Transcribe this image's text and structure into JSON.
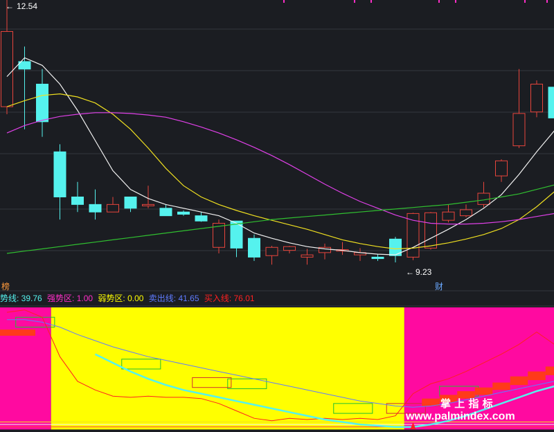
{
  "colors": {
    "background": "#1b1d22",
    "grid": "#33363d",
    "up": "#e8453c",
    "down": "#55f2ee",
    "ma5": "#f2f2f2",
    "ma10": "#f0e020",
    "ma20": "#e040e8",
    "ma60": "#30c030",
    "strong_zone": "#ff0aa0",
    "weak_zone": "#ffff00",
    "trend_line": "#4aa8ff",
    "sell_line": "#5f7bff",
    "buy_line": "#ff2020",
    "box_green": "#20c030",
    "box_red": "#d03030",
    "watermark": "#ffffff",
    "marker": "#ff2ec8"
  },
  "price_panel": {
    "high_label": "12.54",
    "low_label": "9.23",
    "left_badge": "榜",
    "right_badge": "财"
  },
  "indicator_legend": [
    {
      "label": "势线: 39.76",
      "color": "#55f2ee"
    },
    {
      "label": "强势区: 1.00",
      "color": "#ff2ec8"
    },
    {
      "label": "弱势区: 0.00",
      "color": "#ffff00"
    },
    {
      "label": "卖出线: 41.65",
      "color": "#5f7bff"
    },
    {
      "label": "买入线: 76.01",
      "color": "#ff2020"
    }
  ],
  "watermark": {
    "line1": "掌 上 指 标",
    "line2": "www.palmindex.com"
  },
  "chart_data": {
    "type": "candlestick",
    "price_axis": [
      9.0,
      12.7
    ],
    "candles": [
      {
        "o": 11.3,
        "h": 12.8,
        "l": 11.2,
        "c": 12.3
      },
      {
        "o": 11.9,
        "h": 12.1,
        "l": 11.0,
        "c": 11.8
      },
      {
        "o": 11.6,
        "h": 11.8,
        "l": 10.9,
        "c": 11.1
      },
      {
        "o": 10.7,
        "h": 10.8,
        "l": 9.8,
        "c": 10.1
      },
      {
        "o": 10.1,
        "h": 10.3,
        "l": 9.9,
        "c": 10.0
      },
      {
        "o": 10.0,
        "h": 10.2,
        "l": 9.8,
        "c": 9.9
      },
      {
        "o": 9.9,
        "h": 10.1,
        "l": 9.9,
        "c": 10.0
      },
      {
        "o": 10.1,
        "h": 10.1,
        "l": 9.9,
        "c": 9.95
      },
      {
        "o": 10.0,
        "h": 10.25,
        "l": 9.95,
        "c": 10.0
      },
      {
        "o": 9.95,
        "h": 10.0,
        "l": 9.85,
        "c": 9.85
      },
      {
        "o": 9.9,
        "h": 9.92,
        "l": 9.85,
        "c": 9.87
      },
      {
        "o": 9.85,
        "h": 9.9,
        "l": 9.77,
        "c": 9.78
      },
      {
        "o": 9.43,
        "h": 9.8,
        "l": 9.35,
        "c": 9.75
      },
      {
        "o": 9.78,
        "h": 9.78,
        "l": 9.3,
        "c": 9.42
      },
      {
        "o": 9.55,
        "h": 9.6,
        "l": 9.25,
        "c": 9.3
      },
      {
        "o": 9.32,
        "h": 9.45,
        "l": 9.2,
        "c": 9.43
      },
      {
        "o": 9.39,
        "h": 9.45,
        "l": 9.35,
        "c": 9.44
      },
      {
        "o": 9.3,
        "h": 9.41,
        "l": 9.2,
        "c": 9.33
      },
      {
        "o": 9.36,
        "h": 9.48,
        "l": 9.27,
        "c": 9.43
      },
      {
        "o": 9.38,
        "h": 9.5,
        "l": 9.33,
        "c": 9.4
      },
      {
        "o": 9.33,
        "h": 9.42,
        "l": 9.25,
        "c": 9.36
      },
      {
        "o": 9.3,
        "h": 9.34,
        "l": 9.25,
        "c": 9.28
      },
      {
        "o": 9.54,
        "h": 9.57,
        "l": 9.23,
        "c": 9.32
      },
      {
        "o": 9.3,
        "h": 9.89,
        "l": 9.26,
        "c": 9.88
      },
      {
        "o": 9.42,
        "h": 9.9,
        "l": 9.4,
        "c": 9.89
      },
      {
        "o": 9.79,
        "h": 10.0,
        "l": 9.76,
        "c": 9.9
      },
      {
        "o": 9.85,
        "h": 10.0,
        "l": 9.83,
        "c": 9.93
      },
      {
        "o": 10.0,
        "h": 10.3,
        "l": 9.96,
        "c": 10.15
      },
      {
        "o": 10.38,
        "h": 10.6,
        "l": 10.3,
        "c": 10.58
      },
      {
        "o": 10.78,
        "h": 11.8,
        "l": 10.75,
        "c": 11.21
      },
      {
        "o": 11.23,
        "h": 11.65,
        "l": 11.16,
        "c": 11.6
      },
      {
        "o": 11.56,
        "h": 11.59,
        "l": 11.05,
        "c": 11.15
      },
      {
        "o": 11.35,
        "h": 12.0,
        "l": 10.9,
        "c": 11.75
      }
    ],
    "ma_series": [
      {
        "key": "ma5",
        "values": [
          11.7,
          11.95,
          11.85,
          11.6,
          11.25,
          10.85,
          10.45,
          10.2,
          10.08,
          10.0,
          9.95,
          9.9,
          9.85,
          9.75,
          9.62,
          9.55,
          9.49,
          9.44,
          9.41,
          9.39,
          9.36,
          9.34,
          9.33,
          9.43,
          9.55,
          9.67,
          9.8,
          9.95,
          10.13,
          10.4,
          10.7,
          10.98,
          11.2
        ]
      },
      {
        "key": "ma10",
        "values": [
          11.3,
          11.38,
          11.45,
          11.47,
          11.43,
          11.35,
          11.2,
          11.0,
          10.75,
          10.48,
          10.25,
          10.1,
          10.0,
          9.92,
          9.85,
          9.79,
          9.73,
          9.67,
          9.6,
          9.53,
          9.48,
          9.44,
          9.41,
          9.42,
          9.45,
          9.49,
          9.54,
          9.6,
          9.68,
          9.8,
          9.97,
          10.17,
          10.38
        ]
      },
      {
        "key": "ma20",
        "values": [
          10.95,
          11.05,
          11.12,
          11.17,
          11.2,
          11.22,
          11.22,
          11.21,
          11.19,
          11.16,
          11.1,
          11.03,
          10.95,
          10.86,
          10.76,
          10.65,
          10.53,
          10.4,
          10.27,
          10.15,
          10.04,
          9.95,
          9.86,
          9.79,
          9.75,
          9.74,
          9.74,
          9.75,
          9.77,
          9.8,
          9.84,
          9.88,
          9.93
        ]
      },
      {
        "key": "ma60",
        "values": [
          9.35,
          9.38,
          9.41,
          9.44,
          9.47,
          9.5,
          9.53,
          9.56,
          9.59,
          9.62,
          9.65,
          9.68,
          9.71,
          9.74,
          9.77,
          9.8,
          9.82,
          9.84,
          9.86,
          9.88,
          9.9,
          9.92,
          9.94,
          9.96,
          9.98,
          10.0,
          10.03,
          10.06,
          10.1,
          10.14,
          10.2,
          10.26,
          10.33
        ]
      }
    ],
    "indicator": {
      "range": [
        0,
        100
      ],
      "strong_zone_spans": [
        [
          0,
          2
        ],
        [
          23,
          32
        ]
      ],
      "weak_zone_spans": [
        [
          3,
          22
        ]
      ],
      "zone_band": [
        0.9,
        100
      ],
      "trend_line": [
        88,
        88,
        85,
        78,
        68,
        62,
        55,
        48,
        42,
        37,
        33,
        30,
        27,
        24,
        21,
        18,
        15,
        12,
        9,
        7,
        5,
        4,
        3,
        3,
        5,
        8,
        12,
        17,
        22,
        27,
        32,
        36,
        40
      ],
      "sell_line": [
        90,
        90,
        88,
        84,
        78,
        73,
        68,
        64,
        60,
        57,
        54,
        51,
        48,
        45,
        42,
        39,
        36,
        33,
        30,
        27,
        24,
        22,
        20,
        19,
        20,
        22,
        25,
        28,
        31,
        34,
        37,
        40,
        42
      ],
      "buy_line": [
        96,
        98,
        92,
        60,
        40,
        33,
        28,
        27,
        28,
        27,
        27,
        26,
        22,
        16,
        10,
        8,
        10,
        9,
        10,
        9,
        10,
        9,
        12,
        30,
        38,
        42,
        48,
        55,
        62,
        70,
        80,
        70,
        76
      ],
      "green_boxes": [
        [
          1,
          84,
          92
        ],
        [
          7,
          50,
          58
        ],
        [
          13,
          34,
          42
        ],
        [
          19,
          14,
          22
        ],
        [
          25,
          28,
          36
        ]
      ],
      "red_boxes": [
        [
          11,
          35,
          43
        ],
        [
          22,
          14,
          22
        ]
      ],
      "buy_blocks": [
        [
          24,
          20,
          26
        ],
        [
          25,
          23,
          29
        ],
        [
          26,
          26,
          32
        ],
        [
          27,
          29,
          35
        ],
        [
          28,
          33,
          39
        ],
        [
          29,
          37,
          44
        ],
        [
          30,
          41,
          48
        ],
        [
          31,
          45,
          52
        ],
        [
          32,
          49,
          56
        ]
      ],
      "marker_index": 23,
      "baselines": [
        3,
        5,
        7
      ]
    }
  }
}
